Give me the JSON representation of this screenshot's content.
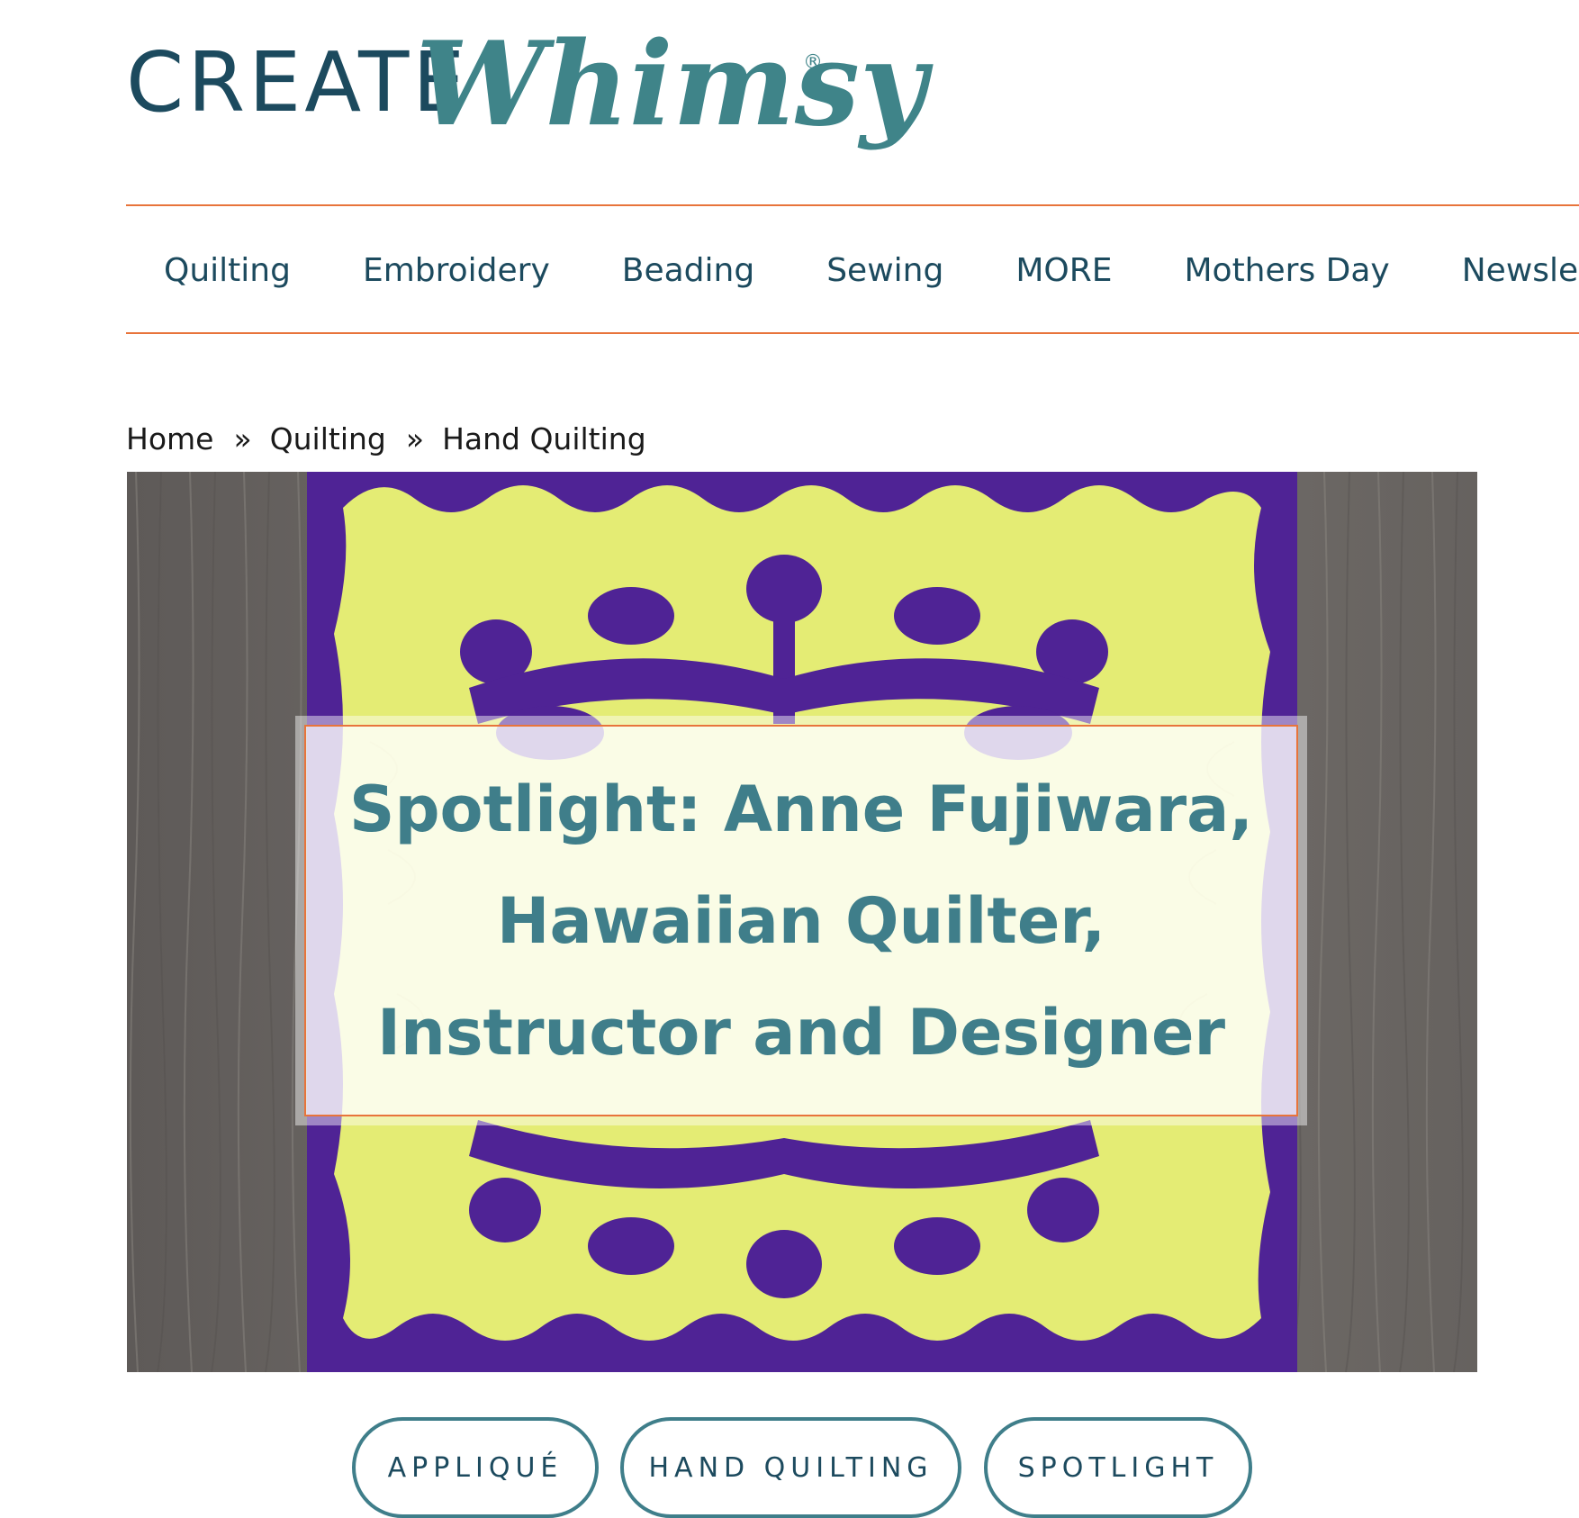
{
  "brand": {
    "logo_create": "CREATE",
    "logo_whimsy": "Whimsy",
    "logo_reg": "®"
  },
  "nav": {
    "items": [
      "Quilting",
      "Embroidery",
      "Beading",
      "Sewing",
      "MORE",
      "Mothers Day",
      "Newsletter Signup"
    ]
  },
  "breadcrumb": {
    "items": [
      "Home",
      "Quilting",
      "Hand Quilting"
    ],
    "separator": "»"
  },
  "hero": {
    "title": "Spotlight: Anne Fujiwara, Hawaiian Quilter, Instructor and Designer"
  },
  "tags": [
    "APPLIQUÉ",
    "HAND QUILTING",
    "SPOTLIGHT"
  ],
  "colors": {
    "brand_dark": "#1c4a5e",
    "brand_teal": "#3f8489",
    "accent_orange": "#e8743b",
    "quilt_yellow": "#e4ec74",
    "quilt_purple": "#4f2395",
    "wood_gray": "#6f6b68"
  }
}
